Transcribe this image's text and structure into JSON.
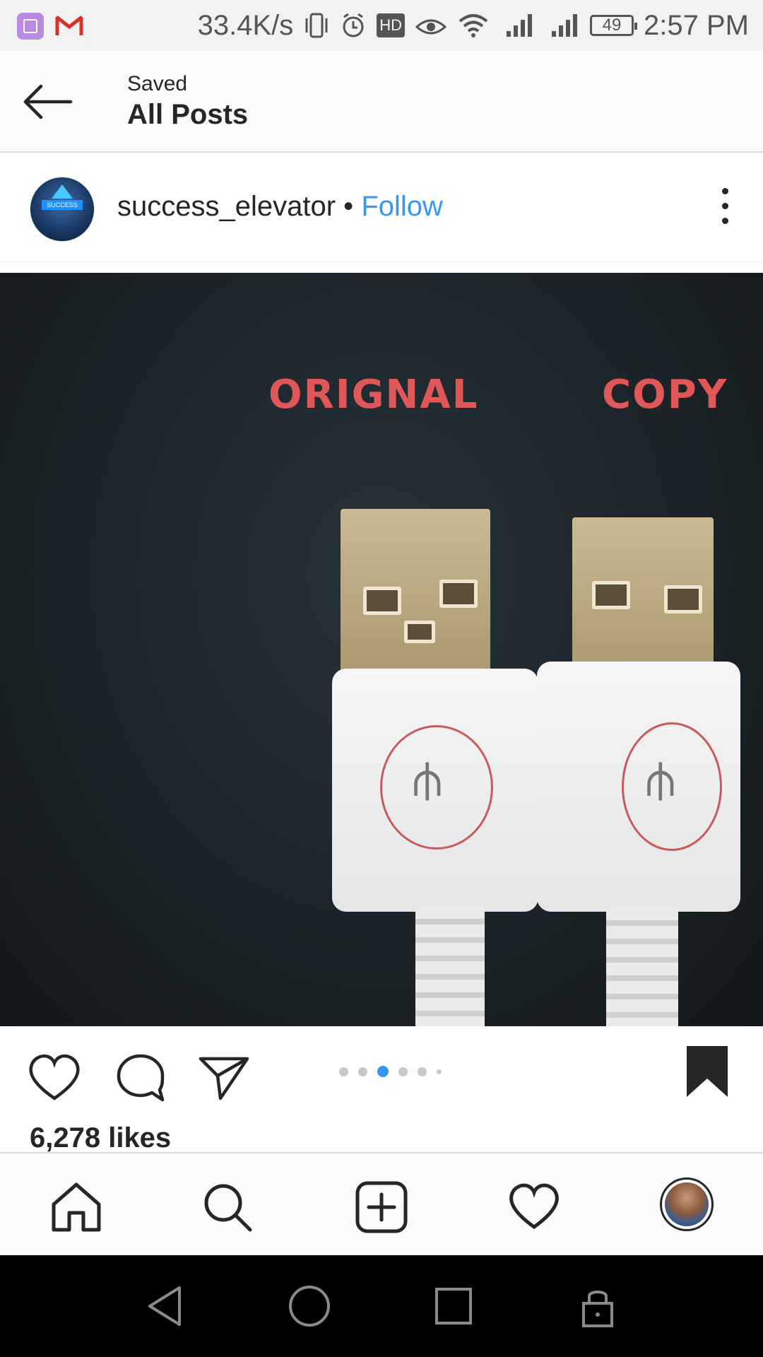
{
  "status_bar": {
    "network_speed": "33.4K/s",
    "hd_badge": "HD",
    "battery": "49",
    "time": "2:57 PM"
  },
  "header": {
    "subtitle": "Saved",
    "title": "All Posts"
  },
  "post": {
    "username": "success_elevator",
    "separator": "•",
    "follow_label": "Follow",
    "avatar_text": "SUCCESS",
    "image_labels": {
      "left": "ORIGNAL",
      "right": "COPY"
    },
    "carousel": {
      "count": 6,
      "active_index": 2
    },
    "likes": "6,278 likes"
  },
  "icons": {
    "back": "arrow-left-icon",
    "more": "more-vertical-icon",
    "like": "heart-icon",
    "comment": "comment-icon",
    "share": "send-icon",
    "saved": "bookmark-filled-icon",
    "home": "home-icon",
    "search": "search-icon",
    "new_post": "plus-square-icon",
    "activity": "heart-icon",
    "profile": "avatar"
  },
  "colors": {
    "link": "#3897f0",
    "text": "#262626",
    "image_label": "#e05757"
  }
}
